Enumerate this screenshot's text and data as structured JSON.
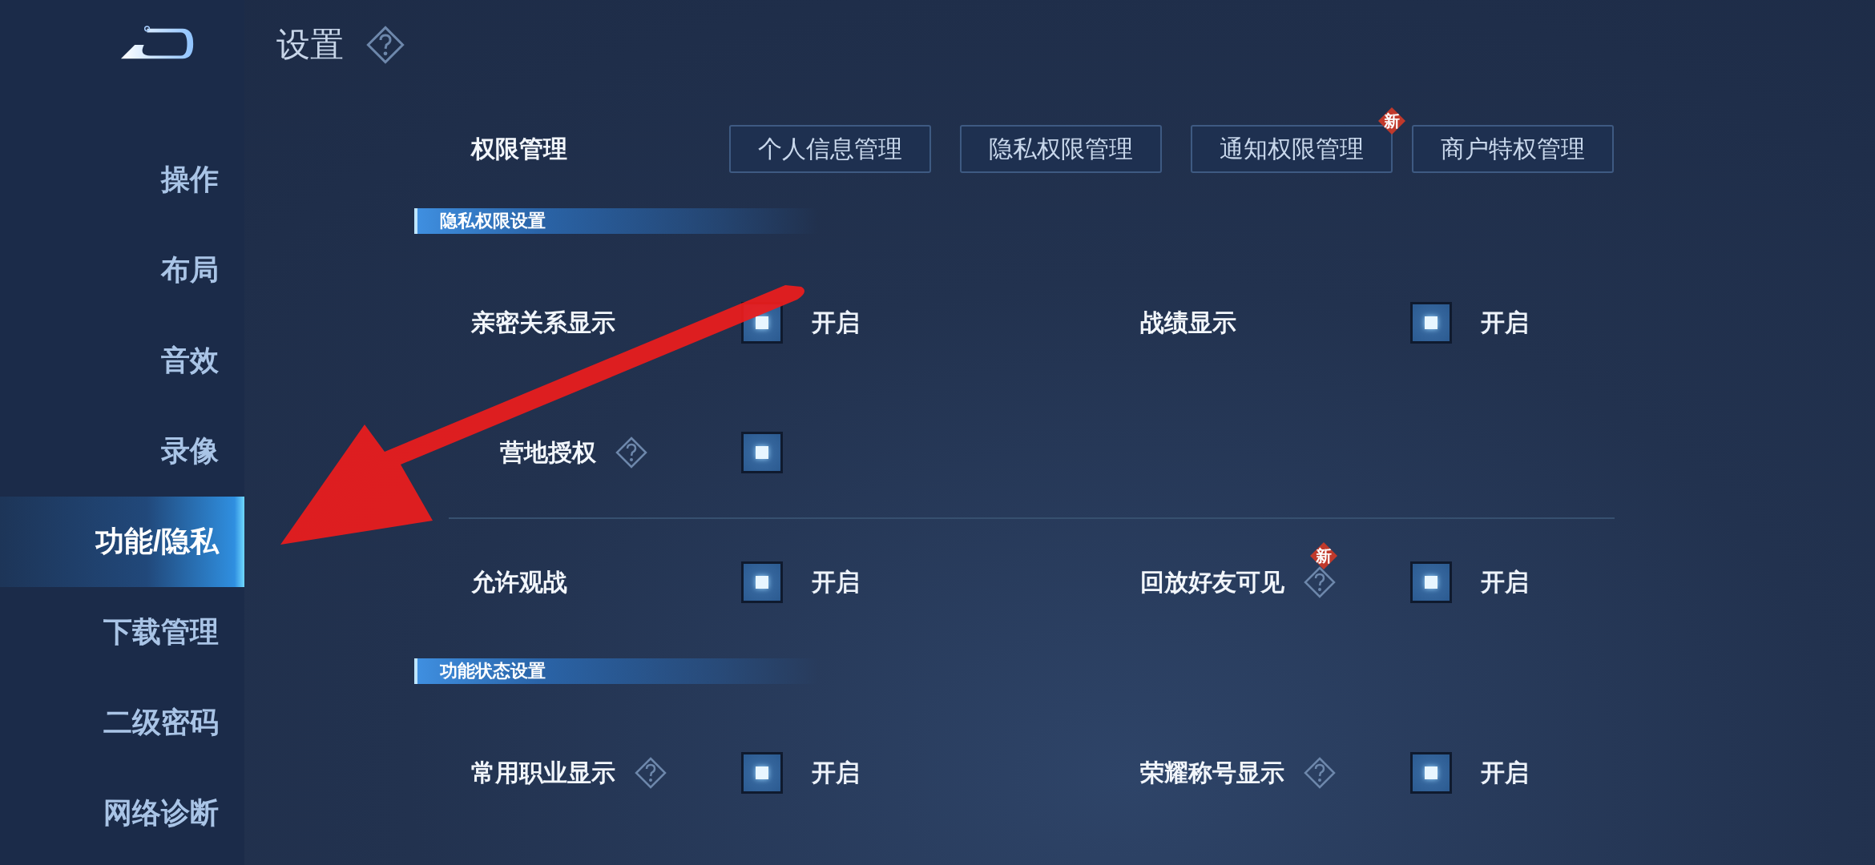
{
  "header": {
    "title": "设置",
    "help": true
  },
  "sidebar": {
    "items": [
      {
        "label": "操作",
        "selected": false
      },
      {
        "label": "布局",
        "selected": false
      },
      {
        "label": "音效",
        "selected": false
      },
      {
        "label": "录像",
        "selected": false
      },
      {
        "label": "功能/隐私",
        "selected": true
      },
      {
        "label": "下载管理",
        "selected": false
      },
      {
        "label": "二级密码",
        "selected": false
      },
      {
        "label": "网络诊断",
        "selected": false
      }
    ]
  },
  "permissions": {
    "label": "权限管理",
    "buttons": [
      {
        "label": "个人信息管理"
      },
      {
        "label": "隐私权限管理"
      },
      {
        "label": "通知权限管理",
        "badge": "新"
      },
      {
        "label": "商户特权管理"
      }
    ]
  },
  "sections": [
    {
      "title": "隐私权限设置",
      "rows": [
        {
          "divider_before": false,
          "items": [
            {
              "label": "亲密关系显示",
              "help": false,
              "checked": true,
              "state_label": "开启"
            },
            {
              "label": "战绩显示",
              "help": false,
              "checked": true,
              "state_label": "开启"
            }
          ]
        },
        {
          "divider_before": false,
          "items": [
            {
              "label": "营地授权",
              "help": true,
              "checked": true
            }
          ]
        },
        {
          "divider_before": true,
          "items": [
            {
              "label": "允许观战",
              "help": false,
              "checked": true,
              "state_label": "开启"
            },
            {
              "label": "回放好友可见",
              "help": true,
              "badge": "新",
              "checked": true,
              "state_label": "开启"
            }
          ]
        }
      ]
    },
    {
      "title": "功能状态设置",
      "rows": [
        {
          "divider_before": false,
          "items": [
            {
              "label": "常用职业显示",
              "help": true,
              "checked": true,
              "state_label": "开启"
            },
            {
              "label": "荣耀称号显示",
              "help": true,
              "checked": true,
              "state_label": "开启"
            }
          ]
        }
      ]
    }
  ]
}
